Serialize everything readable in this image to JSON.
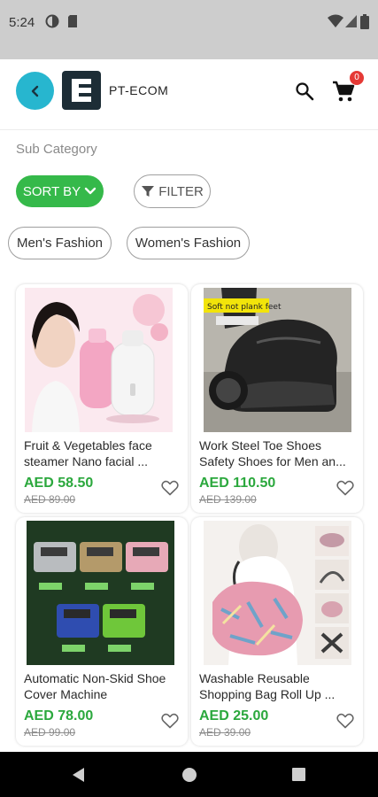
{
  "status": {
    "time": "5:24"
  },
  "header": {
    "brand": "PT-ECOM",
    "cart_count": "0"
  },
  "sub_category_label": "Sub Category",
  "controls": {
    "sort_label": "SORT BY",
    "filter_label": "FILTER"
  },
  "chips": [
    "Men's Fashion",
    "Women's Fashion"
  ],
  "products": [
    {
      "title": "Fruit & Vegetables face steamer Nano facial ...",
      "price": "AED 58.50",
      "old_price": "AED 89.00"
    },
    {
      "title": "Work Steel Toe Shoes Safety Shoes for Men an...",
      "price": "AED 110.50",
      "old_price": "AED 139.00",
      "image_label": "Soft not plank feet"
    },
    {
      "title": "Automatic Non-Skid Shoe Cover Machine",
      "price": "AED 78.00",
      "old_price": "AED 99.00"
    },
    {
      "title": "Washable Reusable Shopping Bag Roll Up ...",
      "price": "AED 25.00",
      "old_price": "AED 39.00"
    }
  ],
  "colors": {
    "accent": "#27b6cf",
    "sort": "#35b94a",
    "price": "#2ba83d",
    "badge": "#e53935"
  },
  "icons": {
    "back": "arrow-left-icon",
    "search": "search-icon",
    "cart": "cart-icon",
    "filter": "funnel-icon",
    "sort": "chevron-down-icon",
    "wishlist": "heart-outline-icon"
  }
}
